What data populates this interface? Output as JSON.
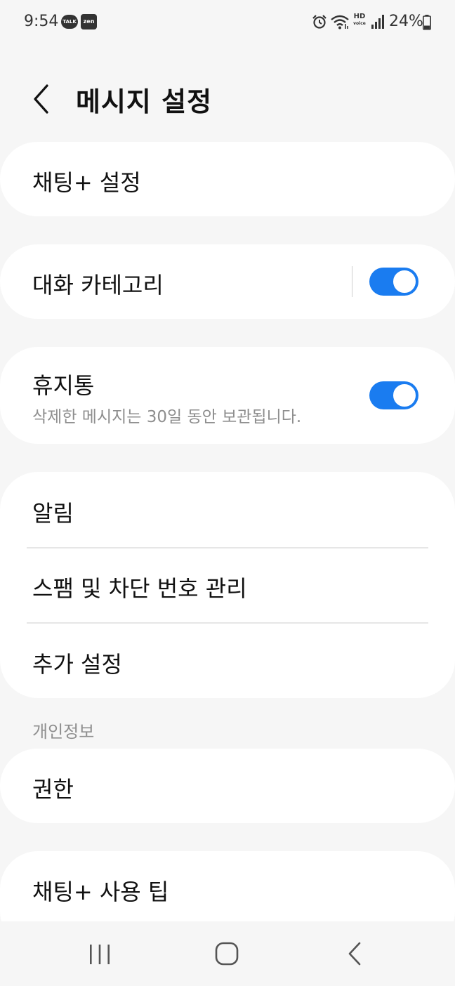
{
  "status_bar": {
    "time": "9:54",
    "talk_badge": "TALK",
    "zen_badge": "zen",
    "hd_top": "HD",
    "hd_bottom": "voice",
    "battery": "24%"
  },
  "header": {
    "title": "메시지 설정"
  },
  "settings": {
    "chat_plus": "채팅+ 설정",
    "conversation_categories": "대화 카테고리",
    "conversation_categories_enabled": true,
    "trash": "휴지통",
    "trash_desc": "삭제한 메시지는 30일 동안 보관됩니다.",
    "trash_enabled": true,
    "notifications": "알림",
    "spam_block": "스팸 및 차단 번호 관리",
    "more_settings": "추가 설정",
    "privacy_header": "개인정보",
    "permissions": "권한",
    "chat_plus_tips": "채팅+ 사용 팁"
  },
  "colors": {
    "accent": "#1a7cf0",
    "background": "#f6f6f6",
    "card": "#ffffff",
    "secondary_text": "#8e8e8e"
  },
  "icons": {
    "back": "chevron-left-icon",
    "alarm": "alarm-icon",
    "wifi": "wifi-icon",
    "signal": "signal-icon",
    "battery": "battery-icon",
    "nav_recents": "recents-icon",
    "nav_home": "home-icon",
    "nav_back": "back-icon"
  }
}
